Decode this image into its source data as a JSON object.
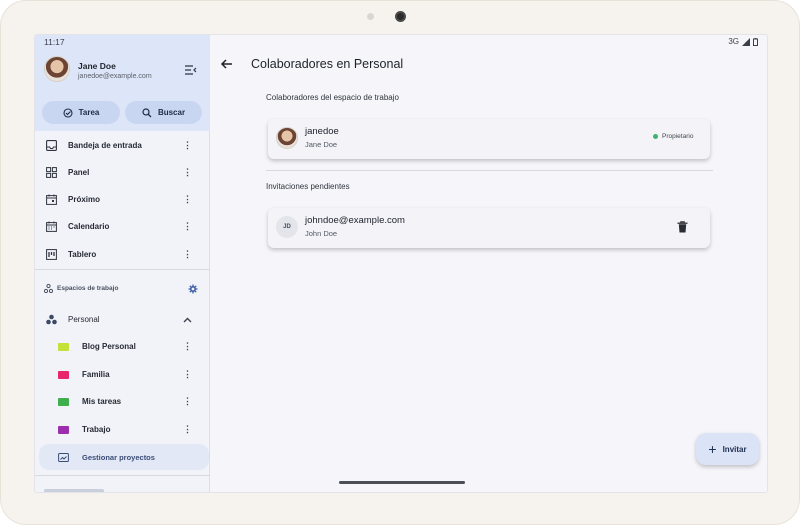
{
  "device": {
    "frame": "tablet"
  },
  "status_bar": {
    "time": "11:17",
    "network": "3G"
  },
  "user": {
    "name": "Jane Doe",
    "email": "janedoe@example.com"
  },
  "quick_actions": {
    "task_label": "Tarea",
    "search_label": "Buscar"
  },
  "nav": [
    {
      "label": "Bandeja de entrada",
      "icon": "inbox-icon"
    },
    {
      "label": "Panel",
      "icon": "dashboard-icon"
    },
    {
      "label": "Próximo",
      "icon": "calendar-upcoming-icon"
    },
    {
      "label": "Calendario",
      "icon": "calendar-icon"
    },
    {
      "label": "Tablero",
      "icon": "board-icon"
    }
  ],
  "workspaces": {
    "header": "Espacios de trabajo",
    "current": "Personal",
    "projects": [
      {
        "label": "Blog Personal",
        "color": "#c6e03a"
      },
      {
        "label": "Familia",
        "color": "#e8266a"
      },
      {
        "label": "Mis tareas",
        "color": "#3fae4d"
      },
      {
        "label": "Trabajo",
        "color": "#9b2fae"
      }
    ],
    "manage_label": "Gestionar proyectos"
  },
  "page": {
    "title": "Colaboradores en Personal",
    "collaborators_section": "Colaboradores del espacio de trabajo",
    "collaborator": {
      "username": "janedoe",
      "name": "Jane Doe",
      "role": "Propietario"
    },
    "invitations_section": "Invitaciones pendientes",
    "invitation": {
      "initials": "JD",
      "email": "johndoe@example.com",
      "name": "John Doe"
    },
    "invite_label": "Invitar"
  },
  "colors": {
    "accent": "#3f5fa6",
    "owner_status": "#3cb371",
    "sidebar_header": "#dde6f8"
  }
}
